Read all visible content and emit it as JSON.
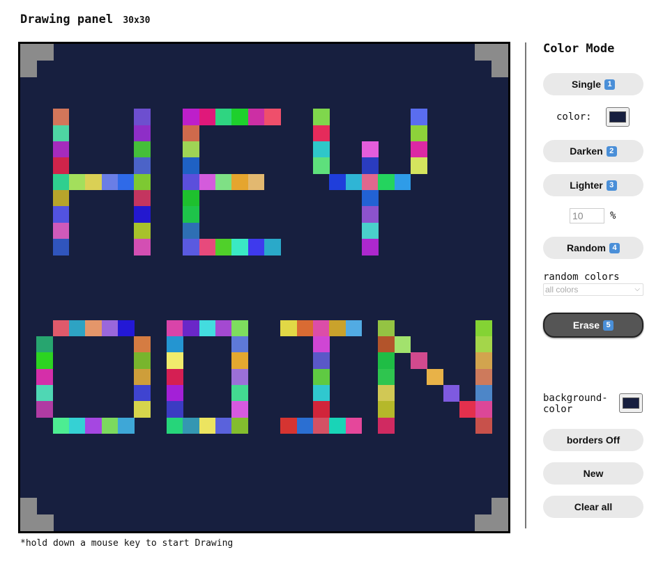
{
  "header": {
    "title": "Drawing panel",
    "size": "30x30"
  },
  "hint": "*hold down a mouse key to start Drawing",
  "board": {
    "background": "#171f3f",
    "grid_size": 30,
    "cells": [
      [
        "#d3765a",
        2,
        4
      ],
      [
        "#4ed5a3",
        2,
        5
      ],
      [
        "#a52bbd",
        2,
        6
      ],
      [
        "#cf244a",
        2,
        7
      ],
      [
        "#2fcf8f",
        2,
        8
      ],
      [
        "#b7a42b",
        2,
        9
      ],
      [
        "#5253e0",
        2,
        10
      ],
      [
        "#cf5aba",
        2,
        11
      ],
      [
        "#3055bd",
        2,
        12
      ],
      [
        "#a3df5c",
        3,
        8
      ],
      [
        "#dad055",
        4,
        8
      ],
      [
        "#6a7ee6",
        5,
        8
      ],
      [
        "#2f6ae8",
        6,
        8
      ],
      [
        "#6d4fcf",
        7,
        4
      ],
      [
        "#8e2ec7",
        7,
        5
      ],
      [
        "#45bf3a",
        7,
        6
      ],
      [
        "#4b63c8",
        7,
        7
      ],
      [
        "#7dc932",
        7,
        8
      ],
      [
        "#c4355f",
        7,
        9
      ],
      [
        "#2318cf",
        7,
        10
      ],
      [
        "#a8c22b",
        7,
        11
      ],
      [
        "#d34fb3",
        7,
        12
      ],
      [
        "#bd1fca",
        10,
        4
      ],
      [
        "#cf6a4c",
        10,
        5
      ],
      [
        "#9fd455",
        10,
        6
      ],
      [
        "#1f61c4",
        10,
        7
      ],
      [
        "#5b4fdc",
        10,
        8
      ],
      [
        "#1ec02e",
        10,
        9
      ],
      [
        "#1ec44a",
        10,
        10
      ],
      [
        "#2e6fb4",
        10,
        11
      ],
      [
        "#5a5ae0",
        10,
        12
      ],
      [
        "#e0187a",
        11,
        4
      ],
      [
        "#2fd581",
        12,
        4
      ],
      [
        "#1ed02c",
        13,
        4
      ],
      [
        "#cc2fa4",
        14,
        4
      ],
      [
        "#ef4f6b",
        15,
        4
      ],
      [
        "#d45bdc",
        11,
        8
      ],
      [
        "#7fe085",
        12,
        8
      ],
      [
        "#e5a52e",
        13,
        8
      ],
      [
        "#e2b870",
        14,
        8
      ],
      [
        "#e74a7c",
        11,
        12
      ],
      [
        "#50d02a",
        12,
        12
      ],
      [
        "#3ae9c4",
        13,
        12
      ],
      [
        "#3e3aed",
        14,
        12
      ],
      [
        "#2aa9c9",
        15,
        12
      ],
      [
        "#7fd74c",
        18,
        4
      ],
      [
        "#e52b5b",
        18,
        5
      ],
      [
        "#2fc7c9",
        18,
        6
      ],
      [
        "#5ee07c",
        18,
        7
      ],
      [
        "#5a6df0",
        24,
        4
      ],
      [
        "#8dd23a",
        24,
        5
      ],
      [
        "#dc29a4",
        24,
        6
      ],
      [
        "#d4e45e",
        24,
        7
      ],
      [
        "#e45ddc",
        21,
        6
      ],
      [
        "#2a3cc0",
        21,
        7
      ],
      [
        "#1f3edb",
        19,
        8
      ],
      [
        "#2fb5d5",
        20,
        8
      ],
      [
        "#e0678e",
        21,
        8
      ],
      [
        "#24d45e",
        22,
        8
      ],
      [
        "#2f9ce8",
        23,
        8
      ],
      [
        "#2262d4",
        21,
        9
      ],
      [
        "#8c53cd",
        21,
        10
      ],
      [
        "#4ad0cb",
        21,
        11
      ],
      [
        "#ad28ce",
        21,
        12
      ],
      [
        "#df5a6b",
        2,
        17
      ],
      [
        "#2ea3c3",
        3,
        17
      ],
      [
        "#e4966a",
        4,
        17
      ],
      [
        "#9a67db",
        5,
        17
      ],
      [
        "#2318d6",
        6,
        17
      ],
      [
        "#27a56f",
        1,
        18
      ],
      [
        "#2cd421",
        1,
        19
      ],
      [
        "#d52fa9",
        1,
        20
      ],
      [
        "#4fd7b4",
        1,
        21
      ],
      [
        "#b03ba3",
        1,
        22
      ],
      [
        "#d57c42",
        7,
        18
      ],
      [
        "#78b52d",
        7,
        19
      ],
      [
        "#ce9e3a",
        7,
        20
      ],
      [
        "#3f44d0",
        7,
        21
      ],
      [
        "#d6d54c",
        7,
        22
      ],
      [
        "#4ded92",
        2,
        23
      ],
      [
        "#35d1d4",
        3,
        23
      ],
      [
        "#a547e1",
        4,
        23
      ],
      [
        "#7cd95e",
        5,
        23
      ],
      [
        "#3ea7d7",
        6,
        23
      ],
      [
        "#d944a9",
        9,
        17
      ],
      [
        "#6a27c8",
        10,
        17
      ],
      [
        "#43dcdf",
        11,
        17
      ],
      [
        "#a449d1",
        12,
        17
      ],
      [
        "#7edd5e",
        13,
        17
      ],
      [
        "#2495d1",
        9,
        18
      ],
      [
        "#f1ec6c",
        9,
        19
      ],
      [
        "#d51f53",
        9,
        20
      ],
      [
        "#a320d7",
        9,
        21
      ],
      [
        "#3b3cc3",
        9,
        22
      ],
      [
        "#5e79d8",
        13,
        18
      ],
      [
        "#e4a830",
        13,
        19
      ],
      [
        "#9b70d8",
        13,
        20
      ],
      [
        "#43d991",
        13,
        21
      ],
      [
        "#d65ae0",
        13,
        22
      ],
      [
        "#26d57a",
        9,
        23
      ],
      [
        "#3497b2",
        10,
        23
      ],
      [
        "#ece460",
        11,
        23
      ],
      [
        "#5a62dc",
        12,
        23
      ],
      [
        "#83bd2e",
        13,
        23
      ],
      [
        "#e1d846",
        16,
        17
      ],
      [
        "#d96b33",
        17,
        17
      ],
      [
        "#dc4da8",
        18,
        17
      ],
      [
        "#c9a22c",
        19,
        17
      ],
      [
        "#52abe3",
        20,
        17
      ],
      [
        "#cf46d4",
        18,
        18
      ],
      [
        "#5a58c8",
        18,
        19
      ],
      [
        "#5fca42",
        18,
        20
      ],
      [
        "#30c8cf",
        18,
        21
      ],
      [
        "#d1253a",
        18,
        22
      ],
      [
        "#d63431",
        16,
        23
      ],
      [
        "#2b6fd2",
        17,
        23
      ],
      [
        "#d45164",
        18,
        23
      ],
      [
        "#19d4b7",
        19,
        23
      ],
      [
        "#e5479b",
        20,
        23
      ],
      [
        "#94c343",
        22,
        17
      ],
      [
        "#b3542b",
        22,
        18
      ],
      [
        "#1fbd45",
        22,
        19
      ],
      [
        "#2fc54f",
        22,
        20
      ],
      [
        "#d1c855",
        22,
        21
      ],
      [
        "#b5b82a",
        22,
        22
      ],
      [
        "#d02a61",
        22,
        23
      ],
      [
        "#a2e26d",
        23,
        18
      ],
      [
        "#d14a8e",
        24,
        19
      ],
      [
        "#e8b248",
        25,
        20
      ],
      [
        "#7e5ae0",
        26,
        21
      ],
      [
        "#e3304d",
        27,
        22
      ],
      [
        "#84d334",
        28,
        17
      ],
      [
        "#a4d64a",
        28,
        18
      ],
      [
        "#d2a44e",
        28,
        19
      ],
      [
        "#cd7a5c",
        28,
        20
      ],
      [
        "#4d86c8",
        28,
        21
      ],
      [
        "#dc4798",
        28,
        22
      ],
      [
        "#c8514b",
        28,
        23
      ]
    ]
  },
  "panel": {
    "title": "Color Mode",
    "single_label": "Single",
    "single_key": "1",
    "color_label": "color:",
    "color_value": "#171f3f",
    "darken_label": "Darken",
    "darken_key": "2",
    "lighter_label": "Lighter",
    "lighter_key": "3",
    "percent_value": "10",
    "percent_unit": "%",
    "random_label": "Random",
    "random_key": "4",
    "random_colors_label": "random colors",
    "random_colors_selected": "all colors",
    "erase_label": "Erase",
    "erase_key": "5",
    "background_label": "background-color",
    "background_value": "#171f3f",
    "borders_label": "borders Off",
    "new_label": "New",
    "clear_label": "Clear all"
  },
  "colors": {
    "active_button": "#555555",
    "button": "#e9e9e9",
    "divider": "#777777"
  }
}
